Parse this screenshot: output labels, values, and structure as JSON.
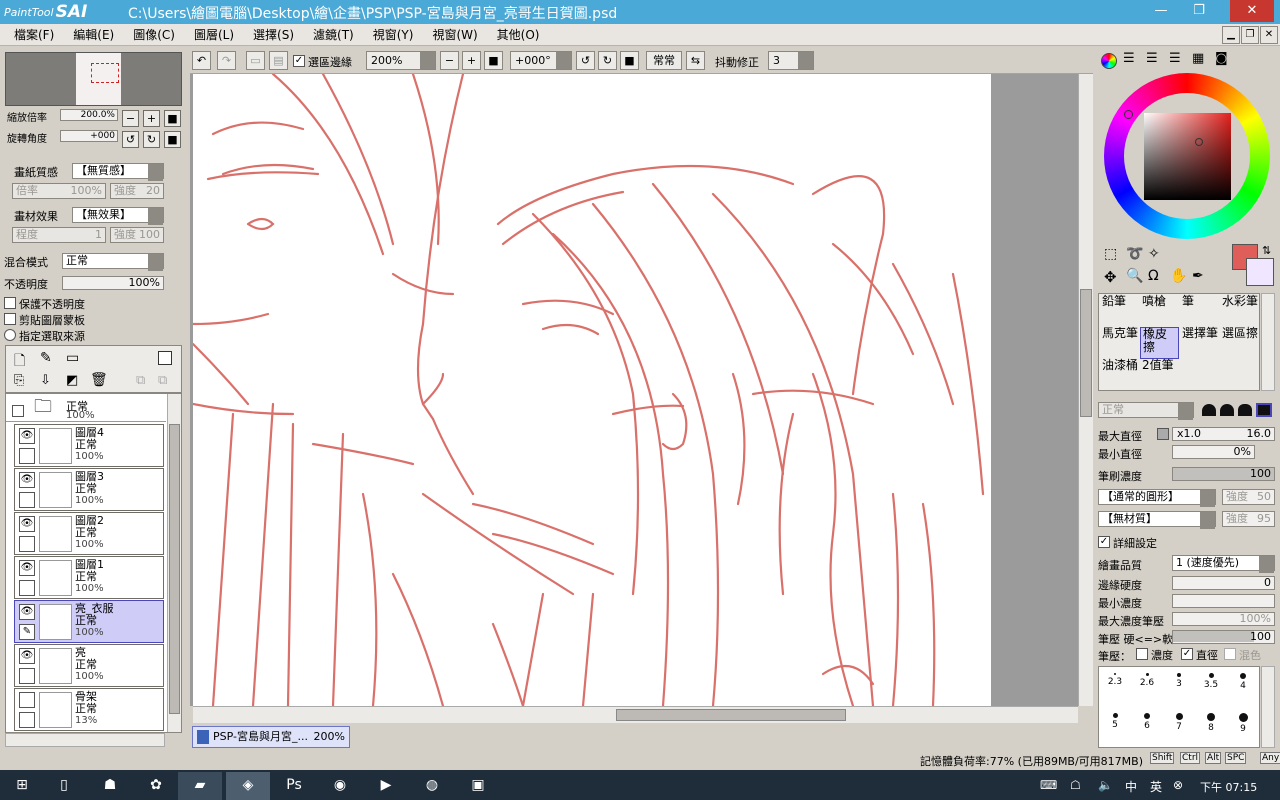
{
  "window": {
    "app_logo_small": "PaintTool",
    "app_logo_big": "SAI",
    "title": "C:\\Users\\繪圖電腦\\Desktop\\繪\\企畫\\PSP\\PSP-宮島與月宮_亮哥生日賀圖.psd",
    "minimize": "—",
    "maximize": "❐",
    "close": "✕"
  },
  "menu": [
    "檔案(F)",
    "編輯(E)",
    "圖像(C)",
    "圖層(L)",
    "選擇(S)",
    "濾鏡(T)",
    "視窗(Y)",
    "視窗(W)",
    "其他(O)"
  ],
  "toolbar": {
    "selection_edge_label": "選區邊緣",
    "zoom_value": "200%",
    "rotate_value": "+000°",
    "blend_label": "常常",
    "stabilizer_label": "抖動修正",
    "stabilizer_value": "3"
  },
  "navigator": {
    "zoom_label": "縮放倍率",
    "zoom_value": "200.0%",
    "rotate_label": "旋轉角度",
    "rotate_value": "+000"
  },
  "paper": {
    "texture_label": "畫紙質感",
    "texture_value": "【無質感】",
    "scale_label": "倍率",
    "scale_value": "100%",
    "strength_label": "強度",
    "strength_value": "20",
    "effect_label": "畫材效果",
    "effect_value": "【無效果】",
    "degree_label": "程度",
    "degree_value": "1",
    "effect_strength_label": "強度",
    "effect_strength_value": "100"
  },
  "blend": {
    "mode_label": "混合模式",
    "mode_value": "正常",
    "opacity_label": "不透明度",
    "opacity_value": "100%",
    "preserve_opacity": "保護不透明度",
    "clipping_group": "剪貼圖層蒙板",
    "selection_source": "指定選取來源"
  },
  "layers": [
    {
      "name": "",
      "mode": "正常",
      "opacity": "100%",
      "folder": true
    },
    {
      "name": "圖層4",
      "mode": "正常",
      "opacity": "100%",
      "visible": true
    },
    {
      "name": "圖層3",
      "mode": "正常",
      "opacity": "100%",
      "visible": true
    },
    {
      "name": "圖層2",
      "mode": "正常",
      "opacity": "100%",
      "visible": true
    },
    {
      "name": "圖層1",
      "mode": "正常",
      "opacity": "100%",
      "visible": true
    },
    {
      "name": "亮_衣服",
      "mode": "正常",
      "opacity": "100%",
      "visible": true,
      "selected": true
    },
    {
      "name": "亮",
      "mode": "正常",
      "opacity": "100%",
      "visible": true
    },
    {
      "name": "骨架",
      "mode": "正常",
      "opacity": "13%",
      "visible": false
    }
  ],
  "doc_tab": {
    "name": "PSP-宮島與月宮_...",
    "zoom": "200%"
  },
  "tools": [
    {
      "label": "鉛筆"
    },
    {
      "label": "噴槍"
    },
    {
      "label": "筆"
    },
    {
      "label": "水彩筆"
    },
    {
      "label": "馬克筆"
    },
    {
      "label": "橡皮擦",
      "selected": true
    },
    {
      "label": "選擇筆"
    },
    {
      "label": "選區擦"
    },
    {
      "label": "油漆桶"
    },
    {
      "label": "2值筆"
    }
  ],
  "brush": {
    "mode_value": "正常",
    "max_size_label": "最大直徑",
    "max_size_mult": "x1.0",
    "max_size_value": "16.0",
    "min_size_label": "最小直徑",
    "min_size_value": "0%",
    "density_label": "筆刷濃度",
    "density_value": "100",
    "shape_value": "【通常的圓形】",
    "shape_strength_label": "強度",
    "shape_strength_value": "50",
    "texture_value": "【無材質】",
    "texture_strength_label": "強度",
    "texture_strength_value": "95",
    "advanced_label": "詳細設定",
    "quality_label": "繪畫品質",
    "quality_value": "1 (速度優先)",
    "edge_hardness_label": "邊緣硬度",
    "edge_hardness_value": "0",
    "min_density_label": "最小濃度",
    "min_density_value": "",
    "max_pressure_label": "最大濃度筆壓",
    "max_pressure_value": "100%",
    "pressure_hardness_label": "筆壓 硬<=>軟",
    "pressure_hardness_value": "100",
    "pressure_label": "筆壓：",
    "pressure_density": "濃度",
    "pressure_size": "直徑",
    "pressure_blend": "混色",
    "opacity_fill": 0.8
  },
  "brush_sizes": [
    [
      "2.3",
      "2.6",
      "3",
      "3.5",
      "4"
    ],
    [
      "5",
      "6",
      "7",
      "8",
      "9"
    ]
  ],
  "status": {
    "memory": "記憶體負荷率:77% (已用89MB/可用817MB)",
    "keys": [
      "Shift",
      "Ctrl",
      "Alt",
      "SPC",
      "Any"
    ]
  },
  "taskbar": {
    "time": "下午 07:15"
  },
  "colors": {
    "titlebar": "#4aa9d6",
    "primary": "#df5e5a",
    "secondary": "#f1e6ff",
    "sketch": "#d9706a",
    "selection": "#cfcdf7"
  }
}
